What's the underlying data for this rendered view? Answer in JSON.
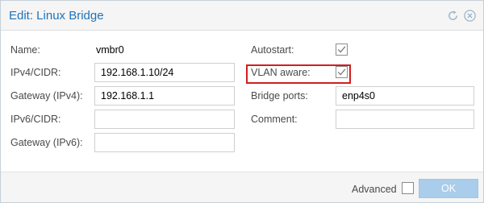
{
  "dialog": {
    "title": "Edit: Linux Bridge",
    "accent_color": "#1e73b9",
    "tools": [
      "reset-icon",
      "close-icon"
    ]
  },
  "form": {
    "name": {
      "label": "Name:",
      "value": "vmbr0"
    },
    "ipv4": {
      "label": "IPv4/CIDR:",
      "value": "192.168.1.10/24"
    },
    "gateway4": {
      "label": "Gateway (IPv4):",
      "value": "192.168.1.1"
    },
    "ipv6": {
      "label": "IPv6/CIDR:",
      "value": ""
    },
    "gateway6": {
      "label": "Gateway (IPv6):",
      "value": ""
    },
    "autostart": {
      "label": "Autostart:",
      "checked": true
    },
    "vlan_aware": {
      "label": "VLAN aware:",
      "checked": true,
      "highlight_color": "#d21e1e"
    },
    "bridge_ports": {
      "label": "Bridge ports:",
      "value": "enp4s0"
    },
    "comment": {
      "label": "Comment:",
      "value": ""
    }
  },
  "footer": {
    "advanced_label": "Advanced",
    "advanced_checked": false,
    "ok_label": "OK"
  }
}
